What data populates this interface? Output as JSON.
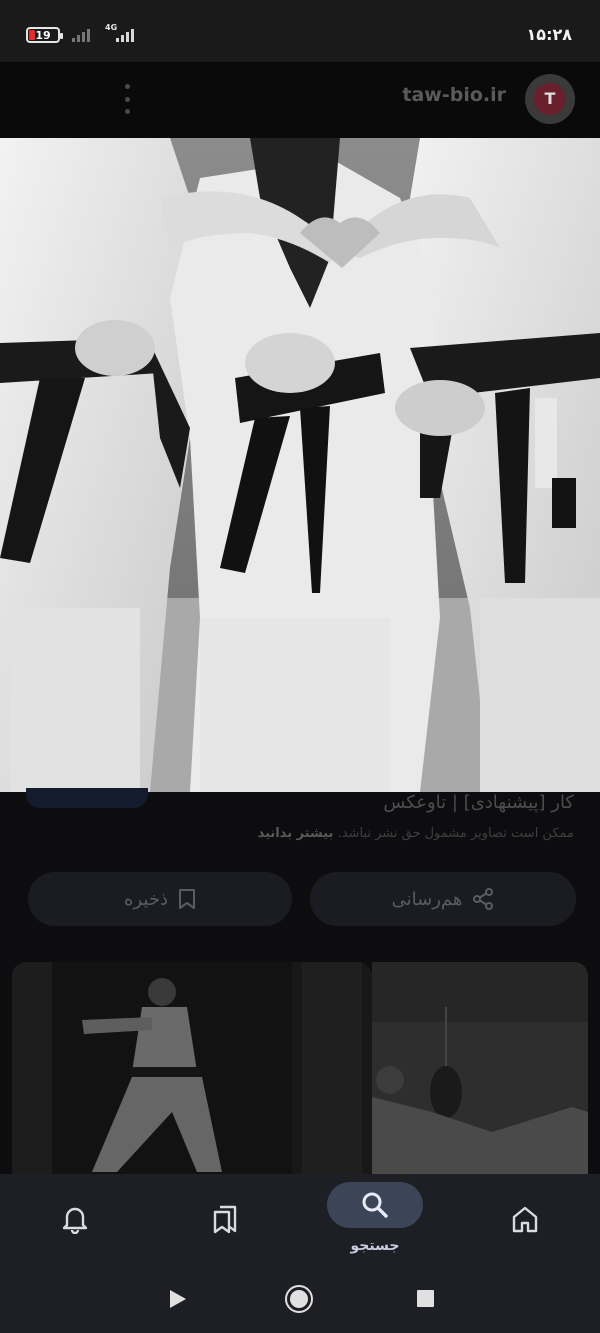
{
  "status_bar": {
    "battery_level": "19",
    "network_type": "4G",
    "time": "۱۵:۲۸"
  },
  "browser_bar": {
    "site_url": "taw-bio.ir"
  },
  "result": {
    "title": "کار [پیشنهادی] | تاوعکس",
    "notice_text": "ممکن است تصاویر مشمول حق نشر نباشد.",
    "learn_more_label": "بیشتر بدانید",
    "save_label": "ذخیره",
    "share_label": "هم‌رسانی"
  },
  "bottom_nav": {
    "active_label": "جستجو",
    "items": [
      "notifications-icon",
      "saved-collections-icon",
      "search-icon",
      "home-icon"
    ]
  },
  "colors": {
    "nav_background": "#1e1f24",
    "active_pill": "#3c4457",
    "battery_low": "#e52b2b"
  }
}
